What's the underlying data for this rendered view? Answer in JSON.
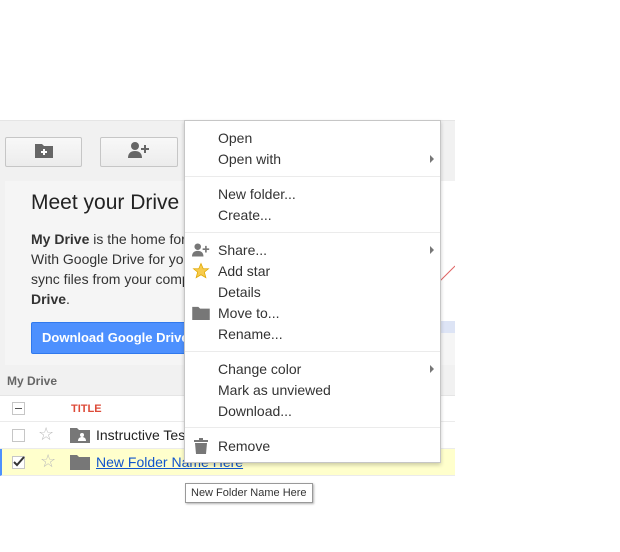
{
  "toolbar": {
    "new_folder_icon": "new-folder-icon",
    "share_icon": "add-person-icon"
  },
  "welcome": {
    "title": "Meet your Drive",
    "line1_bold": "My Drive",
    "line1_rest": " is the home for",
    "line2": "With Google Drive for you",
    "line3": "sync files from your comp",
    "line4_bold": "Drive",
    "line4_rest": ".",
    "download_button": "Download Google Drive"
  },
  "list": {
    "section_label": "My Drive",
    "column_title": "TITLE",
    "rows": [
      {
        "name": "Instructive Test",
        "selected": false,
        "icon": "shared-folder-icon"
      },
      {
        "name": "New Folder Name Here",
        "selected": true,
        "icon": "folder-icon"
      }
    ]
  },
  "tooltip": "New Folder Name Here",
  "context_menu": {
    "items": [
      {
        "label": "Open"
      },
      {
        "label": "Open with",
        "submenu": true
      },
      {
        "label": "New folder..."
      },
      {
        "label": "Create..."
      },
      {
        "label": "Share...",
        "submenu": true,
        "icon": "add-person-icon"
      },
      {
        "label": "Add star",
        "icon": "star-icon"
      },
      {
        "label": "Details"
      },
      {
        "label": "Move to...",
        "icon": "folder-icon"
      },
      {
        "label": "Rename..."
      },
      {
        "label": "Change color",
        "submenu": true
      },
      {
        "label": "Mark as unviewed"
      },
      {
        "label": "Download..."
      },
      {
        "label": "Remove",
        "icon": "trash-icon"
      }
    ]
  },
  "colors": {
    "accent_blue": "#4d90fe",
    "title_red": "#dd4b39",
    "selected_row": "#ffffcc",
    "link": "#1155cc"
  }
}
